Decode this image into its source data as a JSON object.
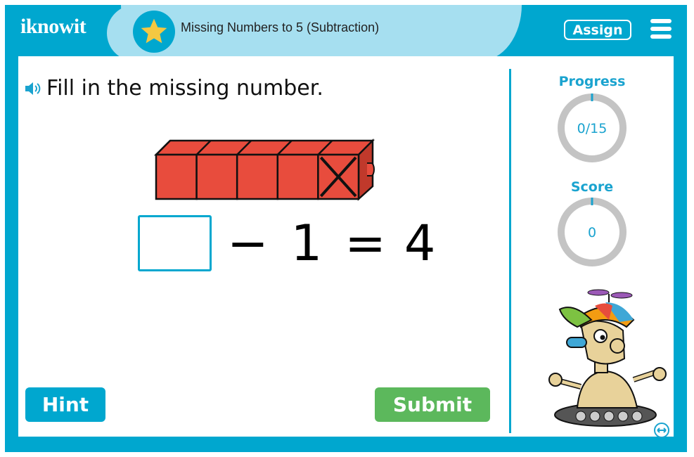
{
  "header": {
    "logo_text": "iknowit",
    "activity_title": "Missing Numbers to 5 (Subtraction)",
    "assign_label": "Assign",
    "icons": {
      "badge": "star-icon",
      "menu": "hamburger-menu-icon"
    }
  },
  "question": {
    "prompt": "Fill in the missing number.",
    "audio_icon": "speaker-icon",
    "blocks": {
      "total": 5,
      "crossed_out": 1,
      "color": "#e84c3d"
    },
    "answer_value": "",
    "operator": "−",
    "operand": "1",
    "equals": "=",
    "result": "4"
  },
  "buttons": {
    "hint_label": "Hint",
    "submit_label": "Submit"
  },
  "sidebar": {
    "progress_label": "Progress",
    "progress_value": "0/15",
    "progress_fraction": 0,
    "score_label": "Score",
    "score_value": "0",
    "mascot": "robot-mascot-icon",
    "swap_icon": "swap-arrows-icon"
  },
  "colors": {
    "brand_blue": "#00a7cf",
    "title_pill": "#a6dff0",
    "submit_green": "#5cb85c",
    "ring_gray": "#c4c4c4",
    "star_yellow": "#f4c842"
  }
}
